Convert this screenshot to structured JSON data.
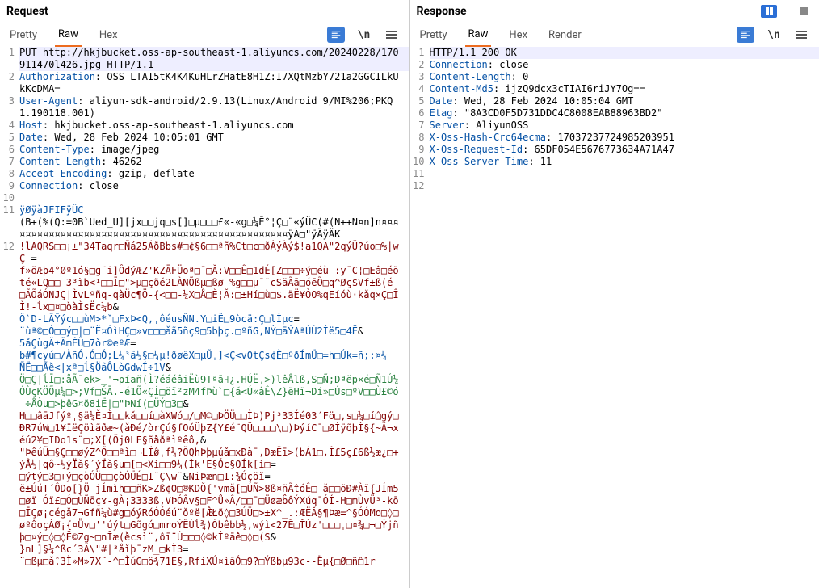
{
  "request": {
    "title": "Request",
    "tabs": [
      "Pretty",
      "Raw",
      "Hex"
    ],
    "activeTab": 1,
    "lines": [
      {
        "n": "1",
        "seg": [
          {
            "c": "",
            "t": "PUT http://hkjbucket.oss-ap-southeast-1.aliyuncs.com/20240228/170911470l426.jpg HTTP/1.1"
          }
        ],
        "cur": true
      },
      {
        "n": "2",
        "seg": [
          {
            "c": "hn",
            "t": "Authorization"
          },
          {
            "c": "",
            "t": ": OSS LTAI5tK4K4KuHLrZHatE8H1Z:I7XQtMzbY721a2GGCILkUkKcDMA="
          }
        ]
      },
      {
        "n": "3",
        "seg": [
          {
            "c": "hn",
            "t": "User-Agent"
          },
          {
            "c": "",
            "t": ": aliyun-sdk-android/2.9.13(Linux/Android 9/MI%206;PKQ1.190118.001)"
          }
        ]
      },
      {
        "n": "4",
        "seg": [
          {
            "c": "hn",
            "t": "Host"
          },
          {
            "c": "",
            "t": ": hkjbucket.oss-ap-southeast-1.aliyuncs.com"
          }
        ]
      },
      {
        "n": "5",
        "seg": [
          {
            "c": "hn",
            "t": "Date"
          },
          {
            "c": "",
            "t": ": Wed, 28 Feb 2024 10:05:01 GMT"
          }
        ]
      },
      {
        "n": "6",
        "seg": [
          {
            "c": "hn",
            "t": "Content-Type"
          },
          {
            "c": "",
            "t": ": image/jpeg"
          }
        ]
      },
      {
        "n": "7",
        "seg": [
          {
            "c": "hn",
            "t": "Content-Length"
          },
          {
            "c": "",
            "t": ": 46262"
          }
        ]
      },
      {
        "n": "8",
        "seg": [
          {
            "c": "hn",
            "t": "Accept-Encoding"
          },
          {
            "c": "",
            "t": ": gzip, deflate"
          }
        ]
      },
      {
        "n": "9",
        "seg": [
          {
            "c": "hn",
            "t": "Connection"
          },
          {
            "c": "",
            "t": ": close"
          }
        ]
      },
      {
        "n": "10",
        "seg": [
          {
            "c": "",
            "t": ""
          }
        ]
      },
      {
        "n": "11",
        "seg": [
          {
            "c": "hn",
            "t": "ÿØÿàJFIFÿÛC"
          }
        ]
      },
      {
        "n": "",
        "seg": [
          {
            "c": "",
            "t": "(B+(%(Q:=0B`Ued_U][jx□□jq□s[]□µ□□□£«-«g□¼Ê°¦Ç□¨«ýÜC(#(N++N¤n]n¤¤¤¤¤¤¤¤¤¤¤¤¤¤¤¤¤¤¤¤¤¤¤¤¤¤¤¤¤¤¤¤¤¤¤¤¤¤¤¤¤¤¤¤¤¤¤¤¤ÿÀ□\"ÿÄÿÄK"
          }
        ]
      },
      {
        "n": "12",
        "seg": [
          {
            "c": "bd1",
            "t": "!lAQRS□□¡±\"34Taqr□Ñá25ÁðBbs#□¢§6□□ªñ%Ct□c□ðÂýÀý$!a1QA\"2qýÜ?úo□%|wÇ "
          },
          {
            "c": "",
            "t": "="
          }
        ]
      },
      {
        "n": "",
        "seg": [
          {
            "c": "bd1",
            "t": "f»öÆþ4°Øº1ó§□g¨i]ÔdýÆZ'KZĀFÜoª□¯□Ǎ:V□□Ê□1dÉ[Z□□□÷ý□éù-:y¯C¦□Eâ□éöté«LQ□□-3³ìb<¹□□Ī□\">µ□çðé2LÀNÕßµ□ßø-%g□□µ¯¨cSäÃā□óēÕ□q^Øç$Vf±ß(é □ÃÕáÓNJÇ|ÌvLºñq-qàÜc¶Ö-{<□□-¼X□Å□È¦Ǎ:□±Hí□ù□$.äË¥ÒO%qEíóù·kǎq×Ç□ÎÌ!-ĺx□¤□òàÌsËc¼b"
          },
          {
            "c": "",
            "t": "&"
          }
        ]
      },
      {
        "n": "",
        "seg": [
          {
            "c": "bd2",
            "t": "Ô`D-LÃŶýc□□ùM>*ˇ□FxÞ<Q,ˌôéusÑN.Y□iÊ□9òcä:Ç□lÌµc"
          },
          {
            "c": "",
            "t": "="
          }
        ]
      },
      {
        "n": "",
        "seg": [
          {
            "c": "bd2",
            "t": "¨ùª©□Ó□□ý□|□¨Ë¤ÒìHÇ□»v□□□ǎã5ñç9□5bþç.□ºñG,NÝ□āÝAªÚÚ2Íë5□4Ë"
          },
          {
            "c": "",
            "t": "&"
          }
        ]
      },
      {
        "n": "",
        "seg": [
          {
            "c": "bd2",
            "t": "5ǎÇùgǍ±ÃmÊÜ□7òr©eºÆ"
          },
          {
            "c": "",
            "t": "="
          }
        ]
      },
      {
        "n": "",
        "seg": [
          {
            "c": "bd2",
            "t": "b#¶cyú□/ÀñÓ,Ó□Ó;L¼³ä½§□¼µ!ðøëX□µŨˌ]<Ç<vOtÇs¢È□ºðÍmÜ□=h□Úk=ñ;:¤¼"
          }
        ]
      },
      {
        "n": "",
        "seg": [
          {
            "c": "bd2",
            "t": "ÑË□□Ã̂è<|xª□ĺ§ÖâÔLòGdwÍ÷1V"
          },
          {
            "c": "",
            "t": "&"
          }
        ]
      },
      {
        "n": "",
        "seg": [
          {
            "c": "bd3",
            "t": "Ö□Ç|ĺĪ□:åÃ¯ek>_'¬píañ(Ì?éáéâiËù9Tªā˧¿.HÚËˌ>)lêÅlß,S□Ñ;Dªëp×é□Ñ1Ú¼ÓÙçKÖÕµ¼□>;Vf□ŠĀ.-é1Õ«ÇÍ□öï²zM4fÞù`□{ǎ<Ú«âÊ\\Z}ëHĩ¬Dí»□Ús□ºV□□Ù£©ó_÷ÅÒu□>þêG¤õ8iË|□\"ÞNí(□ÜÝ□3□"
          },
          {
            "c": "",
            "t": "&"
          }
        ]
      },
      {
        "n": "",
        "seg": [
          {
            "c": "bd1",
            "t": "H□□âāJfýºˌ§ä¼Ě¤Ì□□kǎ□□í□àXWó□/□M©□ÞÖÜ□□ÌÞ)Pj³33Íé03´Fö□,s□¼□í̂□gý□ÐR7úW□1¥ïëÇöìã̂öæ~(ǎÐé/òrÇú§fOóÜþZ{Y£é¨QÜ□□□□\\□)ÞýíC¯□ØÍÿõþÌ§{~Ã¬xéú2¥□IDo1s¨□;X[(Õj0LF§ñ̂àðªìºê̂ô,"
          },
          {
            "c": "",
            "t": "&"
          }
        ]
      },
      {
        "n": "",
        "seg": [
          {
            "c": "bd1",
            "t": "\"ÞêúŨ□§Ç□□øýZ^Õ□□ªì□¬LÍ̂øˌf¼?ÖQhÞþµúǎ□xÐà¯,DæĒī>(bÁ1□,Î£5ç£6ß½æ¿□+ýÅ½|qô~½ýÏǎ§´ýÏǎ§µ□[□<Xì□□9¼(Ìk'E§Óc§OÍk[ǐ□"
          },
          {
            "c": "",
            "t": "="
          }
        ]
      },
      {
        "n": "",
        "seg": [
          {
            "c": "bd1",
            "t": "□ýtý□3□+ý□çòÓÜ□□çòÓÜÉ□I¨Ç\\w¨"
          },
          {
            "c": "",
            "t": "&"
          },
          {
            "c": "bd1",
            "t": "NiÞæn□I:¾Óçöǐ"
          },
          {
            "c": "",
            "t": "="
          }
        ]
      },
      {
        "n": "",
        "seg": [
          {
            "c": "bd1",
            "t": "ë±ÚúT´ÔDo[}Ö-jÍmìh□□ñK>Zß¢O□®KDǑ{'vmǎ[□ÚÑ>8ß¤ñÃ̂tóÊ□-ǎ□□õÐ#Àï{JÍm5□øï_Óï£□Ó□ÙÑōçɤ-gÀ¡3333ß,VÞÓÂv§□F^Ǚ»Â/□□¯□Üøæb̂ôÝXúq¯ÓÍ-H□mÙvÜ³-kō□ĪÇø¡cégǎ7¬Gfñ¼ù#g□óýRóÓÓéú¨ǒºë[Æ̂Łõ◊□3ÚŪ□>±X^_.:ÆËǍ§¶Þæ=^§ÓÓMo□◊□øºôoçÀØ¡{¤Ǚv□''úýt□Gõgó□mroÝËÚĺ¾)Óbêbb½,wýì<27Ê□ŤÚz'□□□ˌ□¤¾□¬□Ýjñþ□¤ý□◊□◊Ë©Zg~□nĬæ(̂ècsì¨,̂oī¨Ú□□□◊©kÍºā̂è□◊□(S"
          },
          {
            "c": "",
            "t": "&"
          }
        ]
      },
      {
        "n": "",
        "seg": [
          {
            "c": "bd1",
            "t": "}nL]§¼^ßc´3Ã\\\"#|³åǐþ¯zM_□kÌ3"
          },
          {
            "c": "",
            "t": "="
          }
        ]
      },
      {
        "n": "",
        "seg": [
          {
            "c": "bd1",
            "t": "¨□ßµ□ǎ̂.3Ì»M»7X¨-^□ÌúG□ö¾71E§,RfiXÚ¤ìāÓ□9?□Ýßbµ93c--Ëµ{□Ø□ñ̂□1r"
          }
        ]
      }
    ]
  },
  "response": {
    "title": "Response",
    "tabs": [
      "Pretty",
      "Raw",
      "Hex",
      "Render"
    ],
    "activeTab": 1,
    "lines": [
      {
        "n": "1",
        "seg": [
          {
            "c": "",
            "t": "HTTP/1.1 200 OK"
          }
        ],
        "cur": true
      },
      {
        "n": "2",
        "seg": [
          {
            "c": "hn",
            "t": "Connection"
          },
          {
            "c": "",
            "t": ": close"
          }
        ]
      },
      {
        "n": "3",
        "seg": [
          {
            "c": "hn",
            "t": "Content-Length"
          },
          {
            "c": "",
            "t": ": 0"
          }
        ]
      },
      {
        "n": "4",
        "seg": [
          {
            "c": "hn",
            "t": "Content-Md5"
          },
          {
            "c": "",
            "t": ": ijzQ9dcx3cTIAI6riJY7Og=="
          }
        ]
      },
      {
        "n": "5",
        "seg": [
          {
            "c": "hn",
            "t": "Date"
          },
          {
            "c": "",
            "t": ": Wed, 28 Feb 2024 10:05:04 GMT"
          }
        ]
      },
      {
        "n": "6",
        "seg": [
          {
            "c": "hn",
            "t": "Etag"
          },
          {
            "c": "",
            "t": ": \"8A3CD0F5D731DDC4C8008EAB88963BD2\""
          }
        ]
      },
      {
        "n": "7",
        "seg": [
          {
            "c": "hn",
            "t": "Server"
          },
          {
            "c": "",
            "t": ": AliyunOSS"
          }
        ]
      },
      {
        "n": "8",
        "seg": [
          {
            "c": "hn",
            "t": "X-Oss-Hash-Crc64ecma"
          },
          {
            "c": "",
            "t": ": 17037237724985203951"
          }
        ]
      },
      {
        "n": "9",
        "seg": [
          {
            "c": "hn",
            "t": "X-Oss-Request-Id"
          },
          {
            "c": "",
            "t": ": 65DF054E5676773634A71A47"
          }
        ]
      },
      {
        "n": "10",
        "seg": [
          {
            "c": "hn",
            "t": "X-Oss-Server-Time"
          },
          {
            "c": "",
            "t": ": 11"
          }
        ]
      },
      {
        "n": "11",
        "seg": [
          {
            "c": "",
            "t": ""
          }
        ]
      },
      {
        "n": "12",
        "seg": [
          {
            "c": "",
            "t": ""
          }
        ]
      }
    ]
  },
  "wrapLabel": "\\n"
}
